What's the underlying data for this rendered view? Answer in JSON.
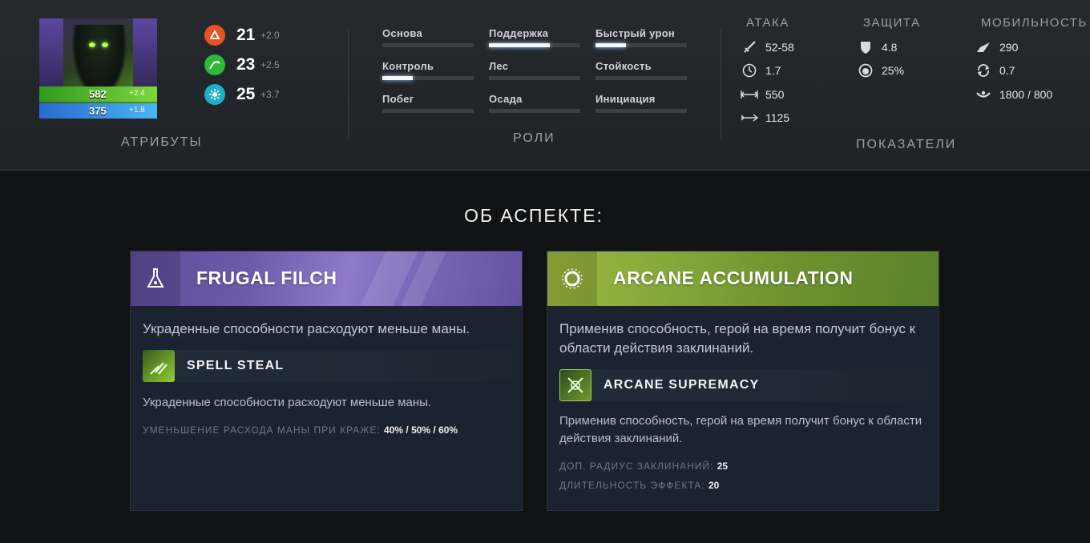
{
  "hero": {
    "hp": "582",
    "hp_regen": "+2.4",
    "mana": "375",
    "mana_regen": "+1.8"
  },
  "attributes": {
    "label": "АТРИБУТЫ",
    "items": [
      {
        "icon": "strength-icon",
        "value": "21",
        "gain": "+2.0",
        "color": "#e8521e"
      },
      {
        "icon": "agility-icon",
        "value": "23",
        "gain": "+2.5",
        "color": "#2fb83a"
      },
      {
        "icon": "intelligence-icon",
        "value": "25",
        "gain": "+3.7",
        "color": "#1fb0c8"
      }
    ]
  },
  "roles": {
    "label": "РОЛИ",
    "items": [
      {
        "name": "Основа",
        "level": 0
      },
      {
        "name": "Поддержка",
        "level": 0.67
      },
      {
        "name": "Быстрый урон",
        "level": 0.33
      },
      {
        "name": "Контроль",
        "level": 0.33
      },
      {
        "name": "Лес",
        "level": 0
      },
      {
        "name": "Стойкость",
        "level": 0
      },
      {
        "name": "Побег",
        "level": 0
      },
      {
        "name": "Осада",
        "level": 0
      },
      {
        "name": "Инициация",
        "level": 0
      }
    ]
  },
  "stats": {
    "label": "ПОКАЗАТЕЛИ",
    "attack": {
      "title": "АТАКА",
      "damage": "52-58",
      "attack_time": "1.7",
      "range": "550",
      "projectile_speed": "1125"
    },
    "defense": {
      "title": "ЗАЩИТА",
      "armor": "4.8",
      "magic_resist": "25%"
    },
    "mobility": {
      "title": "МОБИЛЬНОСТЬ",
      "move_speed": "290",
      "turn_rate": "0.7",
      "vision": "1800 / 800"
    }
  },
  "facets": {
    "title": "ОБ АСПЕКТЕ:",
    "cards": [
      {
        "name": "FRUGAL FILCH",
        "icon": "flask-icon",
        "description": "Украденные способности расходуют меньше маны.",
        "ability": {
          "name": "SPELL STEAL",
          "icon": "spell-steal-icon",
          "description": "Украденные способности расходуют меньше маны.",
          "stats": [
            {
              "label": "УМЕНЬШЕНИЕ РАСХОДА МАНЫ ПРИ КРАЖЕ:",
              "value": "40% / 50% / 60%"
            }
          ]
        }
      },
      {
        "name": "ARCANE ACCUMULATION",
        "icon": "ring-icon",
        "description": "Применив способность, герой на время получит бонус к области действия заклинаний.",
        "ability": {
          "name": "ARCANE SUPREMACY",
          "icon": "arcane-supremacy-icon",
          "description": "Применив способность, герой на время получит бонус к области действия заклинаний.",
          "stats": [
            {
              "label": "ДОП. РАДИУС ЗАКЛИНАНИЙ:",
              "value": "25"
            },
            {
              "label": "ДЛИТЕЛЬНОСТЬ ЭФФЕКТА:",
              "value": "20"
            }
          ]
        }
      }
    ]
  },
  "colors": {
    "purple_facet": "#6c5aa8",
    "green_facet": "#87a83a",
    "hp": "#4fb52a",
    "mana": "#3a8ee0"
  }
}
